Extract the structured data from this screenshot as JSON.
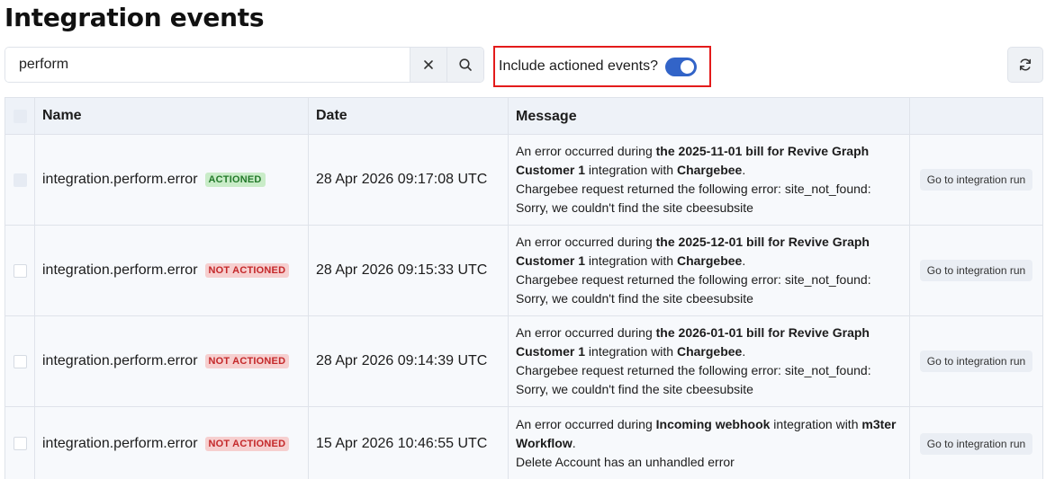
{
  "page": {
    "title": "Integration events"
  },
  "search": {
    "value": "perform",
    "clear_icon": "close-icon",
    "search_icon": "search-icon"
  },
  "toggle": {
    "label": "Include actioned events?",
    "checked": true
  },
  "refresh": {
    "icon": "refresh-icon"
  },
  "table": {
    "columns": [
      "Name",
      "Date",
      "Message",
      ""
    ],
    "rows": [
      {
        "name": "integration.perform.error",
        "status": "ACTIONED",
        "date": "28 Apr 2026 09:17:08 UTC",
        "message": {
          "prefix": "An error occurred during ",
          "subject": "the 2025-11-01 bill for Revive Graph Customer 1",
          "middle": " integration with ",
          "target": "Chargebee",
          "suffix": ".",
          "detail": "Chargebee request returned the following error: site_not_found: Sorry, we couldn't find the site cbeesubsite"
        },
        "action": "Go to integration run"
      },
      {
        "name": "integration.perform.error",
        "status": "NOT ACTIONED",
        "date": "28 Apr 2026 09:15:33 UTC",
        "message": {
          "prefix": "An error occurred during ",
          "subject": "the 2025-12-01 bill for Revive Graph Customer 1",
          "middle": " integration with ",
          "target": "Chargebee",
          "suffix": ".",
          "detail": "Chargebee request returned the following error: site_not_found: Sorry, we couldn't find the site cbeesubsite"
        },
        "action": "Go to integration run"
      },
      {
        "name": "integration.perform.error",
        "status": "NOT ACTIONED",
        "date": "28 Apr 2026 09:14:39 UTC",
        "message": {
          "prefix": "An error occurred during ",
          "subject": "the 2026-01-01 bill for Revive Graph Customer 1",
          "middle": " integration with ",
          "target": "Chargebee",
          "suffix": ".",
          "detail": "Chargebee request returned the following error: site_not_found: Sorry, we couldn't find the site cbeesubsite"
        },
        "action": "Go to integration run"
      },
      {
        "name": "integration.perform.error",
        "status": "NOT ACTIONED",
        "date": "15 Apr 2026 10:46:55 UTC",
        "message": {
          "prefix": "An error occurred during ",
          "subject": "Incoming webhook",
          "middle": " integration with ",
          "target": "m3ter Workflow",
          "suffix": ".",
          "detail": "Delete Account has an unhandled error"
        },
        "action": "Go to integration run"
      }
    ]
  },
  "colors": {
    "accent": "#3264c8",
    "highlight_border": "#e31b1b",
    "actioned_bg": "#c9ecc8",
    "actioned_text": "#247a2b",
    "not_actioned_bg": "#f6cfcf",
    "not_actioned_text": "#c4282a"
  }
}
